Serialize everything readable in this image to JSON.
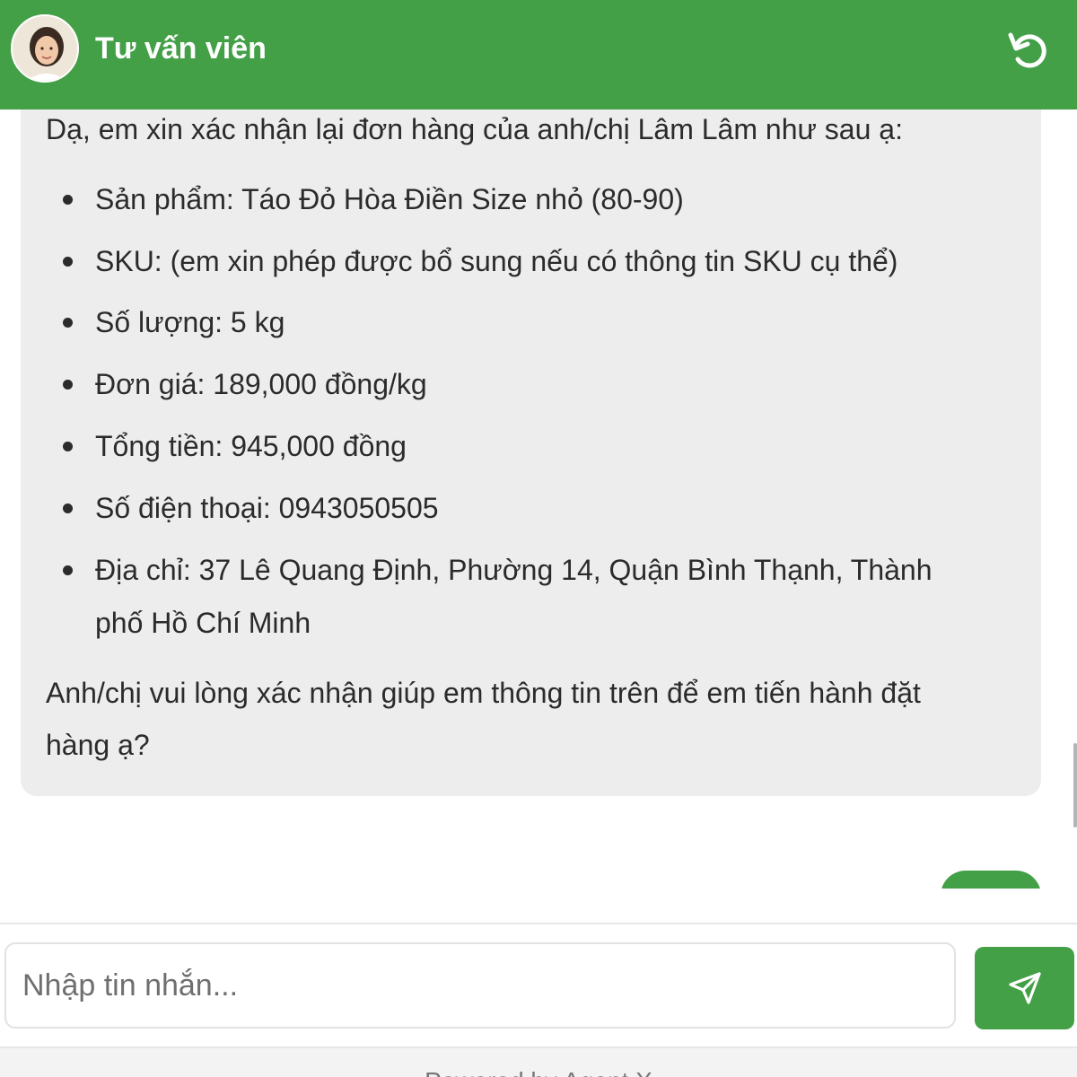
{
  "header": {
    "title": "Tư vấn viên",
    "avatar_icon": "agent-avatar",
    "reset_icon": "refresh-icon",
    "color": "#43a047"
  },
  "message": {
    "intro": "Dạ, em xin xác nhận lại đơn hàng của anh/chị Lâm Lâm như sau ạ:",
    "items": [
      "Sản phẩm: Táo Đỏ Hòa Điền Size nhỏ (80-90)",
      "SKU: (em xin phép được bổ sung nếu có thông tin SKU cụ thể)",
      "Số lượng: 5 kg",
      "Đơn giá: 189,000 đồng/kg",
      "Tổng tiền: 945,000 đồng",
      "Số điện thoại: 0943050505",
      "Địa chỉ: 37 Lê Quang Định, Phường 14, Quận Bình Thạnh, Thành",
      "phố Hồ Chí Minh"
    ],
    "outro_line1": "Anh/chị vui lòng xác nhận giúp em thông tin trên để em tiến hành đặt",
    "outro_line2": "hàng ạ?",
    "bubble_color": "#ededed"
  },
  "composer": {
    "placeholder": "Nhập tin nhắn...",
    "send_icon": "send-icon"
  },
  "footer": {
    "text": "Powered by Agent X"
  }
}
